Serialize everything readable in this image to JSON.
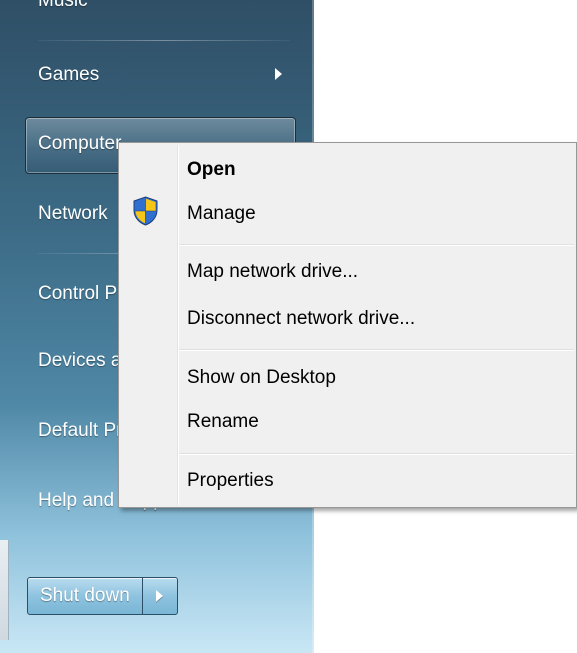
{
  "start_menu": {
    "items": [
      {
        "label": "Music"
      },
      {
        "label": "Games"
      },
      {
        "label": "Computer"
      },
      {
        "label": "Network"
      },
      {
        "label": "Control Panel"
      },
      {
        "label": "Devices and Printers"
      },
      {
        "label": "Default Programs"
      },
      {
        "label": "Help and Support"
      }
    ],
    "shutdown_label": "Shut down"
  },
  "context_menu": {
    "items": [
      {
        "label": "Open"
      },
      {
        "label": "Manage",
        "icon": "uac-shield-icon"
      },
      {
        "label": "Map network drive..."
      },
      {
        "label": "Disconnect network drive..."
      },
      {
        "label": "Show on Desktop"
      },
      {
        "label": "Rename"
      },
      {
        "label": "Properties"
      }
    ]
  },
  "colors": {
    "start_pane_top": "#2f4f66",
    "start_pane_bottom": "#c9e7f5",
    "menu_background": "#f0f0f0",
    "menu_border": "#979797",
    "shield_blue": "#2f6fd0",
    "shield_yellow": "#f5c518"
  }
}
